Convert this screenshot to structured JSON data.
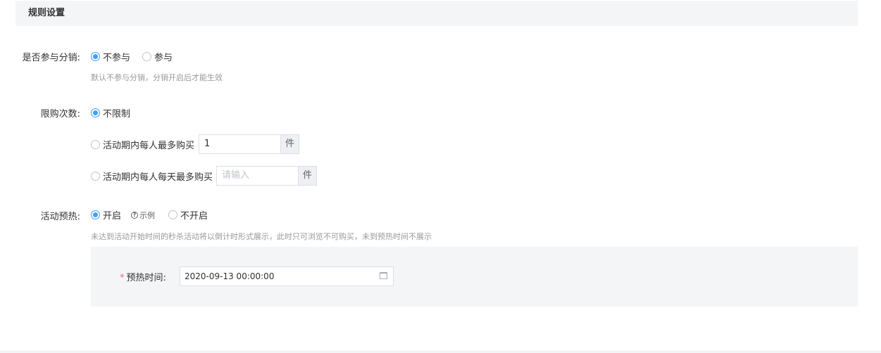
{
  "section": {
    "title": "规则设置"
  },
  "distribution": {
    "label": "是否参与分销:",
    "options": [
      "不参与",
      "参与"
    ],
    "selected": "不参与",
    "tip": "默认不参与分销，分销开启后才能生效"
  },
  "purchase_limit": {
    "label": "限购次数:",
    "options": [
      "不限制",
      "活动期内每人最多购买",
      "活动期内每人每天最多购买"
    ],
    "selected": "不限制",
    "per_person_value": "1",
    "per_day_placeholder": "请输入",
    "unit": "件"
  },
  "preheat": {
    "label": "活动预热:",
    "options": [
      "开启",
      "不开启"
    ],
    "selected": "开启",
    "example_label": "示例",
    "tip": "未达到活动开始时间的秒杀活动将以倒计时形式展示，此时只可浏览不可购买，未到预热时间不展示",
    "time_label": "预热时间:",
    "time_required_mark": "*",
    "time_value": "2020-09-13 00:00:00"
  },
  "colors": {
    "primary": "#409eff",
    "required": "#f56c6c",
    "panel_bg": "#f4f5f7"
  }
}
